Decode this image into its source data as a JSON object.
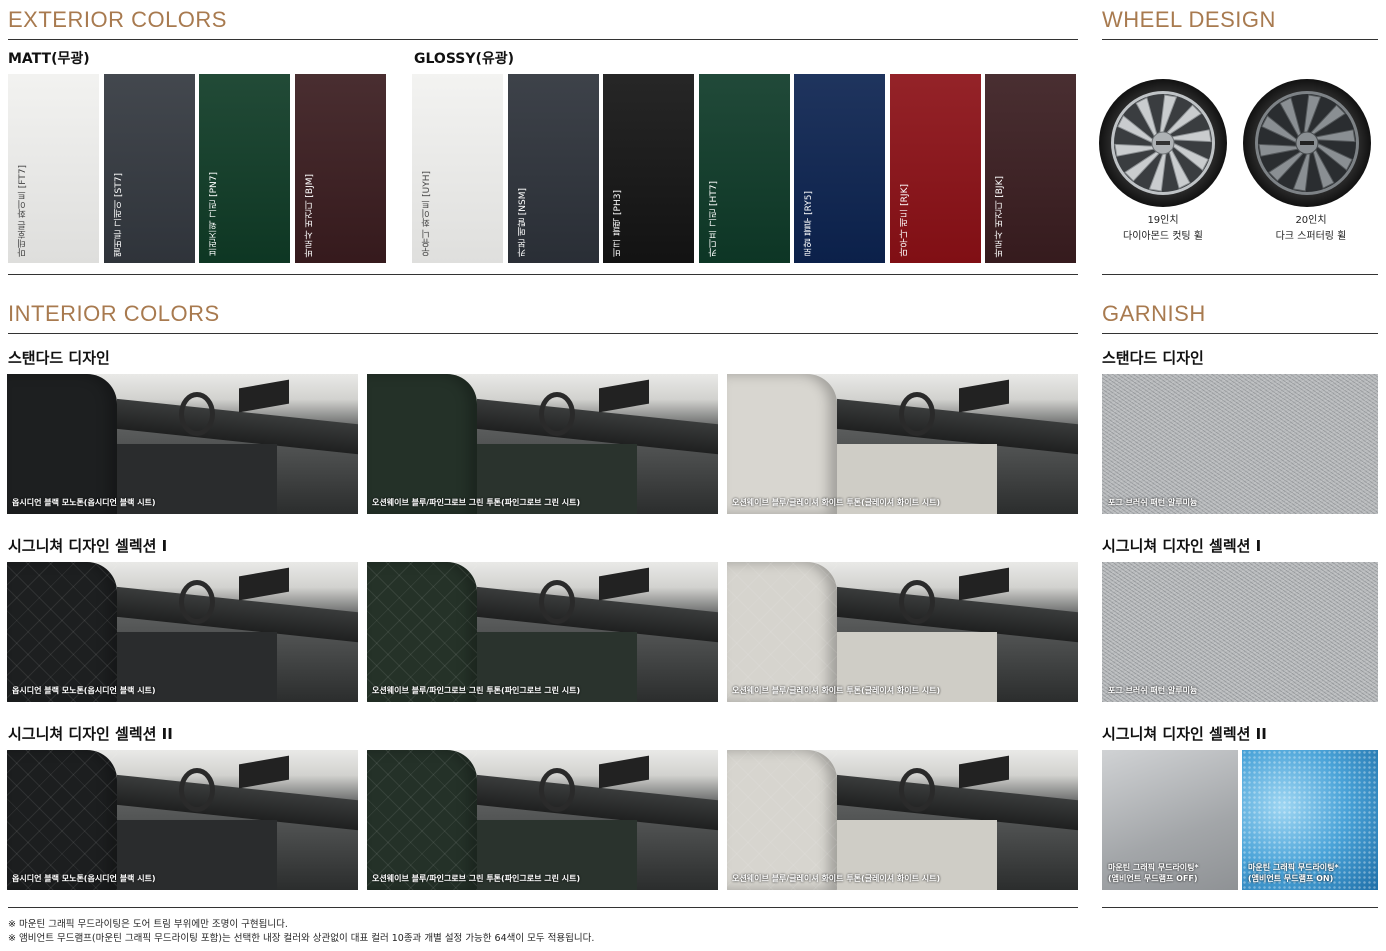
{
  "exterior": {
    "title": "EXTERIOR COLORS",
    "matt_label": "MATT(무광)",
    "glossy_label": "GLOSSY(유광)",
    "matt": [
      {
        "name": "마테호른 화이트 [FT7]",
        "color": "#f1f1ef",
        "text": "#444"
      },
      {
        "name": "멜버른 그레이 [ST7]",
        "color": "#33383f",
        "text": "#fff"
      },
      {
        "name": "브런즈윅 그린 [PN7]",
        "color": "#0f3b26",
        "text": "#fff"
      },
      {
        "name": "바로사 버건디 [BJM]",
        "color": "#3a1c1f",
        "text": "#fff"
      }
    ],
    "glossy": [
      {
        "name": "우유니 화이트 [UYH]",
        "color": "#f2f2f0",
        "text": "#444"
      },
      {
        "name": "카본 메탈 [NSM]",
        "color": "#2d323a",
        "text": "#fff"
      },
      {
        "name": "비크 블랙 [PH3]",
        "color": "#141414",
        "text": "#fff"
      },
      {
        "name": "카디프 그린 [HT7]",
        "color": "#0e3a28",
        "text": "#fff"
      },
      {
        "name": "로얄 블루 [RY5]",
        "color": "#0c2350",
        "text": "#fff"
      },
      {
        "name": "마우나 레드 [RJK]",
        "color": "#8b1016",
        "text": "#fff"
      },
      {
        "name": "바로사 버건디 [BJK]",
        "color": "#3a1d20",
        "text": "#fff"
      }
    ]
  },
  "wheel": {
    "title": "WHEEL DESIGN",
    "items": [
      {
        "size": "19인치",
        "name": "다이아몬드 컷팅 휠"
      },
      {
        "size": "20인치",
        "name": "다크 스퍼터링 휠"
      }
    ]
  },
  "interior": {
    "title": "INTERIOR COLORS",
    "rows": [
      {
        "title": "스탠다드 디자인",
        "tiles": [
          {
            "label": "옵시디언 블랙 모노톤(옵시디언 블랙 시트)",
            "seat": "#1d1f20",
            "trim": "#2a2c2d"
          },
          {
            "label": "오션웨이브 블루/파인그로브 그린 투톤(파인그로브 그린 시트)",
            "seat": "#243128",
            "trim": "#2a332d"
          },
          {
            "label": "오션웨이브 블루/글레이셔 화이트 투톤(글레이셔 화이트 시트)",
            "seat": "#d8d6d0",
            "trim": "#cfcdc6"
          }
        ]
      },
      {
        "title": "시그니쳐 디자인 셀렉션 I",
        "tiles": [
          {
            "label": "옵시디언 블랙 모노톤(옵시디언 블랙 시트)",
            "seat": "#1d1f20",
            "trim": "#2a2c2d"
          },
          {
            "label": "오션웨이브 블루/파인그로브 그린 투톤(파인그로브 그린 시트)",
            "seat": "#253228",
            "trim": "#2a332d"
          },
          {
            "label": "오션웨이브 블루/글레이셔 화이트 투톤(글레이셔 화이트 시트)",
            "seat": "#d6d4ce",
            "trim": "#cfcdc6"
          }
        ]
      },
      {
        "title": "시그니쳐 디자인 셀렉션 II",
        "tiles": [
          {
            "label": "옵시디언 블랙 모노톤(옵시디언 블랙 시트)",
            "seat": "#1c1e1f",
            "trim": "#2a2c2d"
          },
          {
            "label": "오션웨이브 블루/파인그로브 그린 투톤(파인그로브 그린 시트)",
            "seat": "#243128",
            "trim": "#2a332d"
          },
          {
            "label": "오션웨이브 블루/글레이셔 화이트 투톤(글레이셔 화이트 시트)",
            "seat": "#d7d5cf",
            "trim": "#cfcdc6"
          }
        ]
      }
    ]
  },
  "garnish": {
    "title": "GARNISH",
    "rows": [
      {
        "title": "스탠다드 디자인",
        "items": [
          {
            "label": "포그 브러쉬 패턴 알루미늄"
          }
        ]
      },
      {
        "title": "시그니쳐 디자인 셀렉션 I",
        "items": [
          {
            "label": "포그 브러쉬 패턴 알루미늄"
          }
        ]
      },
      {
        "title": "시그니쳐 디자인 셀렉션 II",
        "items": [
          {
            "label": "마운틴 그래픽 무드라이팅*",
            "label2": "(앰비언트 무드램프 OFF)"
          },
          {
            "label": "마운틴 그래픽 무드라이팅*",
            "label2": "(앰비언트 무드램프 ON)"
          }
        ]
      }
    ]
  },
  "footnotes": [
    "※ 마운틴 그래픽 무드라이팅은 도어 트림 부위에만 조명이 구현됩니다.",
    "※ 앰비언트 무드램프(마운틴 그래픽 무드라이팅 포함)는 선택한 내장 컬러와 상관없이 대표 컬러 10종과 개별 설정 가능한 64색이 모두 적용됩니다."
  ]
}
